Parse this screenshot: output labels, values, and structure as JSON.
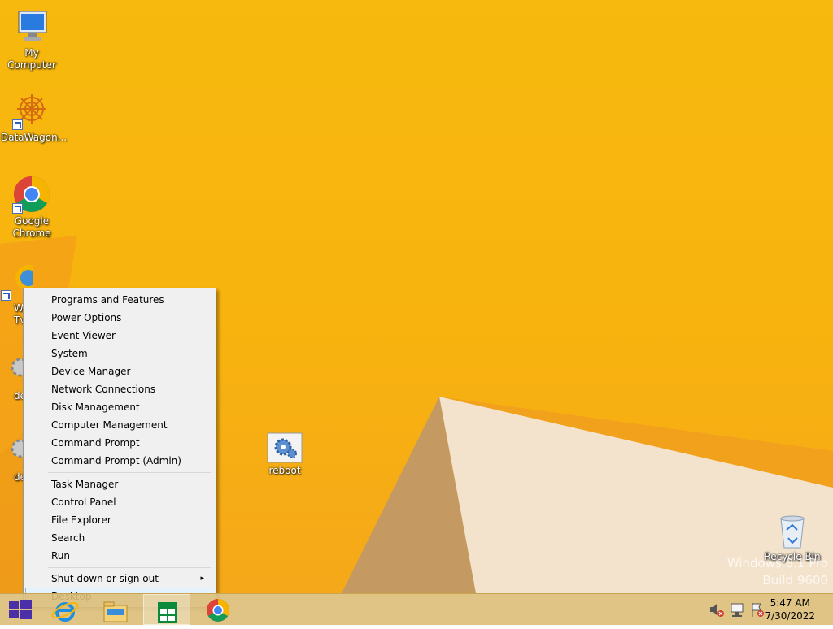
{
  "desktop": {
    "icons": [
      {
        "label": "My Computer"
      },
      {
        "label": "DataWagon..."
      },
      {
        "label": "Google Chrome"
      },
      {
        "label": "W\nTv"
      },
      {
        "label": "de"
      },
      {
        "label": "de"
      },
      {
        "label": "reboot"
      },
      {
        "label": "Recycle Bin"
      }
    ],
    "watermark": {
      "line1": "Windows 8.1 Pro",
      "line2": "Build 9600"
    }
  },
  "context_menu": {
    "items": [
      {
        "label": "Programs and Features"
      },
      {
        "label": "Power Options"
      },
      {
        "label": "Event Viewer"
      },
      {
        "label": "System"
      },
      {
        "label": "Device Manager"
      },
      {
        "label": "Network Connections"
      },
      {
        "label": "Disk Management"
      },
      {
        "label": "Computer Management"
      },
      {
        "label": "Command Prompt"
      },
      {
        "label": "Command Prompt (Admin)"
      },
      {
        "label": "Task Manager"
      },
      {
        "label": "Control Panel"
      },
      {
        "label": "File Explorer"
      },
      {
        "label": "Search"
      },
      {
        "label": "Run"
      },
      {
        "label": "Shut down or sign out"
      },
      {
        "label": "Desktop"
      }
    ],
    "submenu_arrow": "▸"
  },
  "taskbar": {
    "clock": {
      "time": "5:47 AM",
      "date": "7/30/2022"
    },
    "pinned": [
      "internet-explorer-icon",
      "file-explorer-icon",
      "store-icon",
      "chrome-icon"
    ]
  },
  "colors": {
    "wallpaper": "#f7b90e",
    "menu_highlight": "#e5f1fb",
    "taskbar": "#dcbe78"
  }
}
